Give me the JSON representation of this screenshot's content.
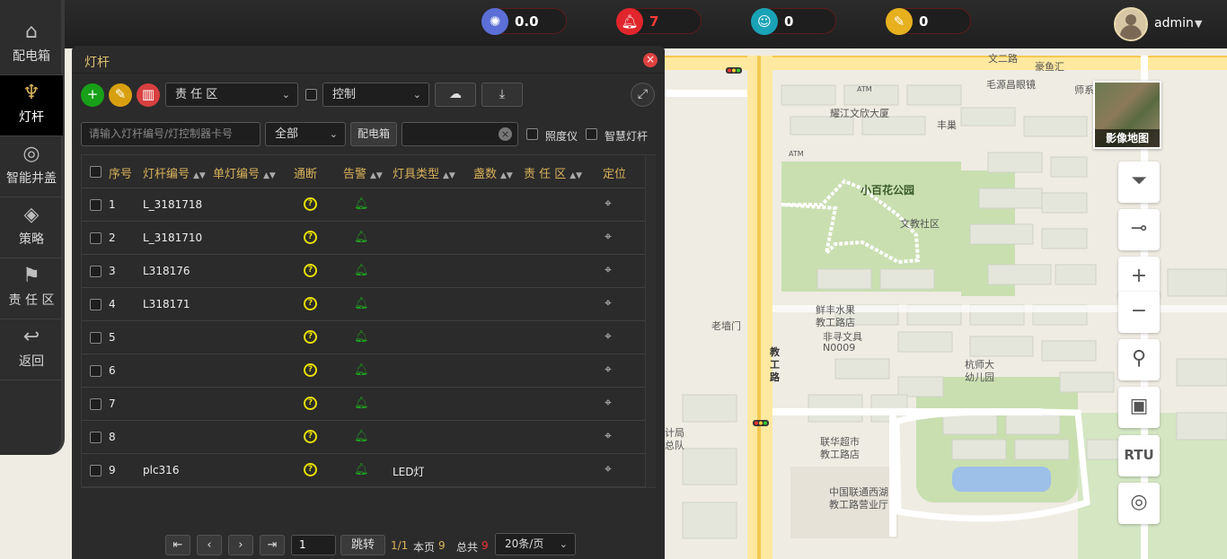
{
  "topbar": {
    "stats": [
      {
        "icon": "sun-icon",
        "value": "0.0",
        "color": "#5b6fd6"
      },
      {
        "icon": "bell-icon",
        "value": "7",
        "color": "#e0262c"
      },
      {
        "icon": "user-icon",
        "value": "0",
        "color": "#1aa3b6"
      },
      {
        "icon": "note-icon",
        "value": "0",
        "color": "#e6b01e"
      }
    ],
    "user": {
      "name": "admin"
    }
  },
  "sidebar": {
    "items": [
      {
        "label": "配电箱",
        "icon": "home-icon"
      },
      {
        "label": "灯杆",
        "icon": "lamp-icon"
      },
      {
        "label": "智能井盖",
        "icon": "manhole-icon"
      },
      {
        "label": "策略",
        "icon": "layers-icon"
      },
      {
        "label": "责 任 区",
        "icon": "flag-icon"
      },
      {
        "label": "返回",
        "icon": "back-icon"
      }
    ]
  },
  "panel": {
    "title": "灯杆",
    "close": "×",
    "zone_select": "责 任 区",
    "control_select": "控制",
    "search_placeholder": "请输入灯杆编号/灯控制器卡号",
    "status_select": "全部",
    "box_button": "配电箱",
    "clear": "×",
    "light_meter_label": "照度仪",
    "smart_pole_label": "智慧灯杆"
  },
  "table": {
    "headers": [
      "序号",
      "灯杆编号",
      "单灯编号",
      "通断",
      "告警",
      "灯具类型",
      "盏数",
      "责 任 区",
      "定位"
    ],
    "rows": [
      {
        "no": "1",
        "pole": "L_3181718",
        "lamp_type": ""
      },
      {
        "no": "2",
        "pole": "L_3181710",
        "lamp_type": ""
      },
      {
        "no": "3",
        "pole": "L318176",
        "lamp_type": ""
      },
      {
        "no": "4",
        "pole": "L318171",
        "lamp_type": ""
      },
      {
        "no": "5",
        "pole": "",
        "lamp_type": ""
      },
      {
        "no": "6",
        "pole": "",
        "lamp_type": ""
      },
      {
        "no": "7",
        "pole": "",
        "lamp_type": ""
      },
      {
        "no": "8",
        "pole": "",
        "lamp_type": ""
      },
      {
        "no": "9",
        "pole": "plc316",
        "lamp_type": "LED灯"
      }
    ]
  },
  "pager": {
    "page_input": "1",
    "jump": "跳转",
    "page_of": "1/1",
    "this_page_label": "本页",
    "this_page_count": "9",
    "total_label": "总共",
    "total_count": "9",
    "per_page": "20条/页"
  },
  "map": {
    "labels": [
      "文二路",
      "豪鱼汇",
      "毛源昌眼镜",
      "师系",
      "ATM",
      "耀江文欣大厦",
      "丰巢",
      "ATM",
      "小百花公园",
      "文教社区",
      "鲜丰水果",
      "教工路店",
      "老墙门",
      "非寻文具",
      "N0009",
      "教",
      "工",
      "路",
      "杭师大",
      "幼儿园",
      "计局",
      "总队",
      "联华超市",
      "教工路店",
      "中国联通西湖",
      "教工路营业厅"
    ],
    "satellite_label": "影像地图",
    "rtu_label": "RTU"
  }
}
